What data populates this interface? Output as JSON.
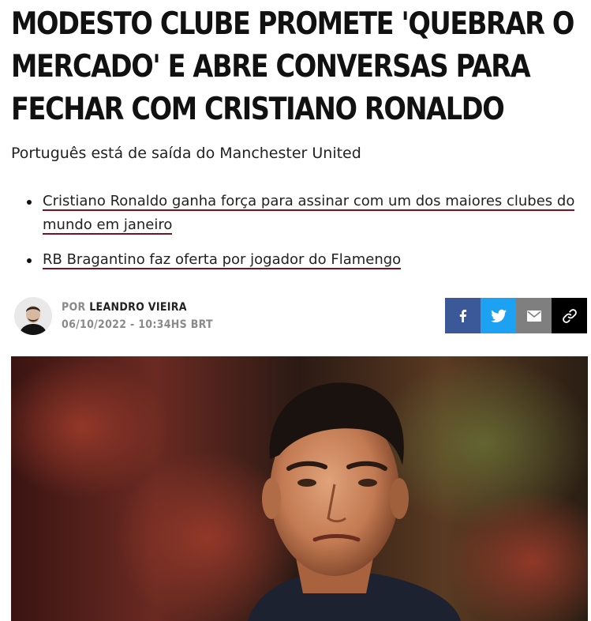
{
  "article": {
    "headline": "Modesto clube promete 'quebrar o mercado' e abre conversas para fechar com Cristiano Ronaldo",
    "subtitle": "Português está de saída do Manchester United",
    "related_links": [
      "Cristiano Ronaldo ganha força para assinar com um dos maiores clubes do mundo em janeiro",
      "RB Bragantino faz oferta por jogador do Flamengo"
    ]
  },
  "author": {
    "prefix": "POR",
    "name": "LEANDRO VIEIRA",
    "datetime": "06/10/2022 - 10:34HS BRT"
  },
  "share": {
    "buttons": [
      {
        "icon": "facebook-icon",
        "color": "#3b5998"
      },
      {
        "icon": "twitter-icon",
        "color": "#1da1f2"
      },
      {
        "icon": "email-icon",
        "color": "#7f7f7f"
      },
      {
        "icon": "link-icon",
        "color": "#000000"
      }
    ]
  },
  "colors": {
    "link_underline": "#7a1020"
  }
}
